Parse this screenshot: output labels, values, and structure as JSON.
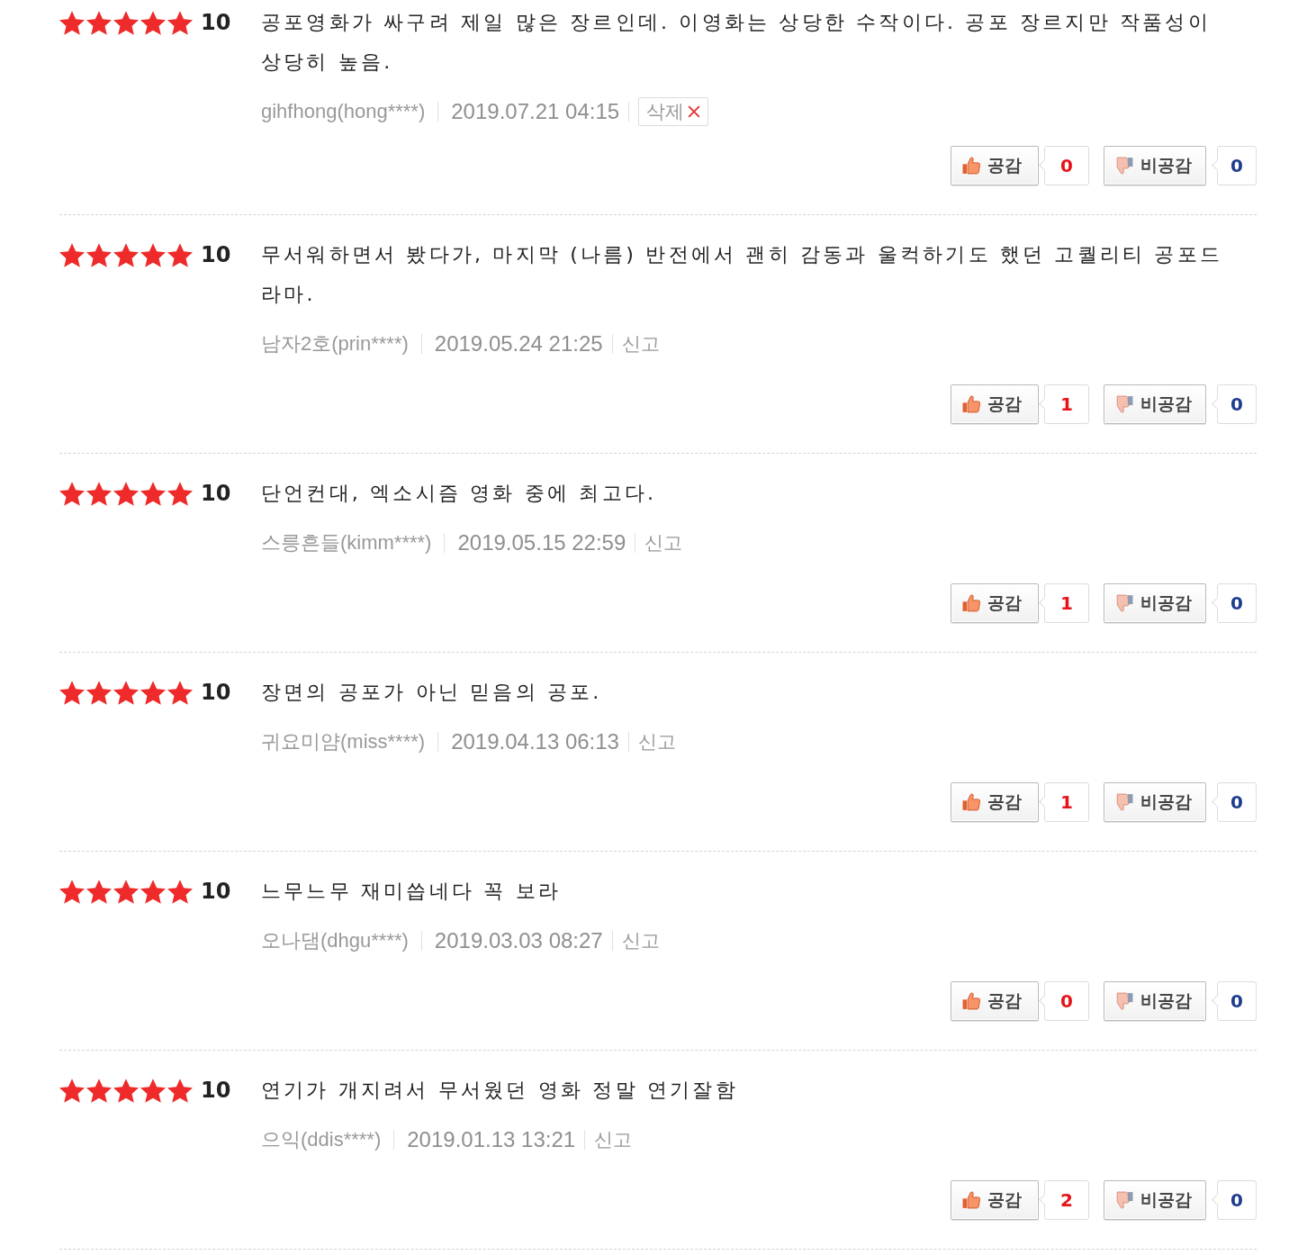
{
  "reviews": [
    {
      "stars": 5,
      "score": "10",
      "text": "공포영화가 싸구려 제일 많은 장르인데. 이영화는 상당한 수작이다. 공포 장르지만 작품성이 상당히 높음.",
      "author": "gihfhong(hong****)",
      "date": "2019.07.21 04:15",
      "action": {
        "kind": "delete",
        "label": "삭제"
      },
      "like": {
        "label": "공감",
        "count": "0"
      },
      "dislike": {
        "label": "비공감",
        "count": "0"
      }
    },
    {
      "stars": 5,
      "score": "10",
      "text": "무서워하면서 봤다가, 마지막 (나름) 반전에서 괜히 감동과 울컥하기도 했던 고퀄리티 공포드라마.",
      "author": "남자2호(prin****)",
      "date": "2019.05.24 21:25",
      "action": {
        "kind": "report",
        "label": "신고"
      },
      "like": {
        "label": "공감",
        "count": "1"
      },
      "dislike": {
        "label": "비공감",
        "count": "0"
      }
    },
    {
      "stars": 5,
      "score": "10",
      "text": "단언컨대, 엑소시즘 영화 중에 최고다.",
      "author": "스릉흔들(kimm****)",
      "date": "2019.05.15 22:59",
      "action": {
        "kind": "report",
        "label": "신고"
      },
      "like": {
        "label": "공감",
        "count": "1"
      },
      "dislike": {
        "label": "비공감",
        "count": "0"
      }
    },
    {
      "stars": 5,
      "score": "10",
      "text": "장면의 공포가 아닌 믿음의 공포.",
      "author": "귀요미얌(miss****)",
      "date": "2019.04.13 06:13",
      "action": {
        "kind": "report",
        "label": "신고"
      },
      "like": {
        "label": "공감",
        "count": "1"
      },
      "dislike": {
        "label": "비공감",
        "count": "0"
      }
    },
    {
      "stars": 5,
      "score": "10",
      "text": "느무느무 재미씁네다 꼭 보라",
      "author": "오나댐(dhgu****)",
      "date": "2019.03.03 08:27",
      "action": {
        "kind": "report",
        "label": "신고"
      },
      "like": {
        "label": "공감",
        "count": "0"
      },
      "dislike": {
        "label": "비공감",
        "count": "0"
      }
    },
    {
      "stars": 5,
      "score": "10",
      "text": "연기가 개지려서 무서웠던 영화 정말 연기잘함",
      "author": "으익(ddis****)",
      "date": "2019.01.13 13:21",
      "action": {
        "kind": "report",
        "label": "신고"
      },
      "like": {
        "label": "공감",
        "count": "2"
      },
      "dislike": {
        "label": "비공감",
        "count": "0"
      }
    }
  ]
}
